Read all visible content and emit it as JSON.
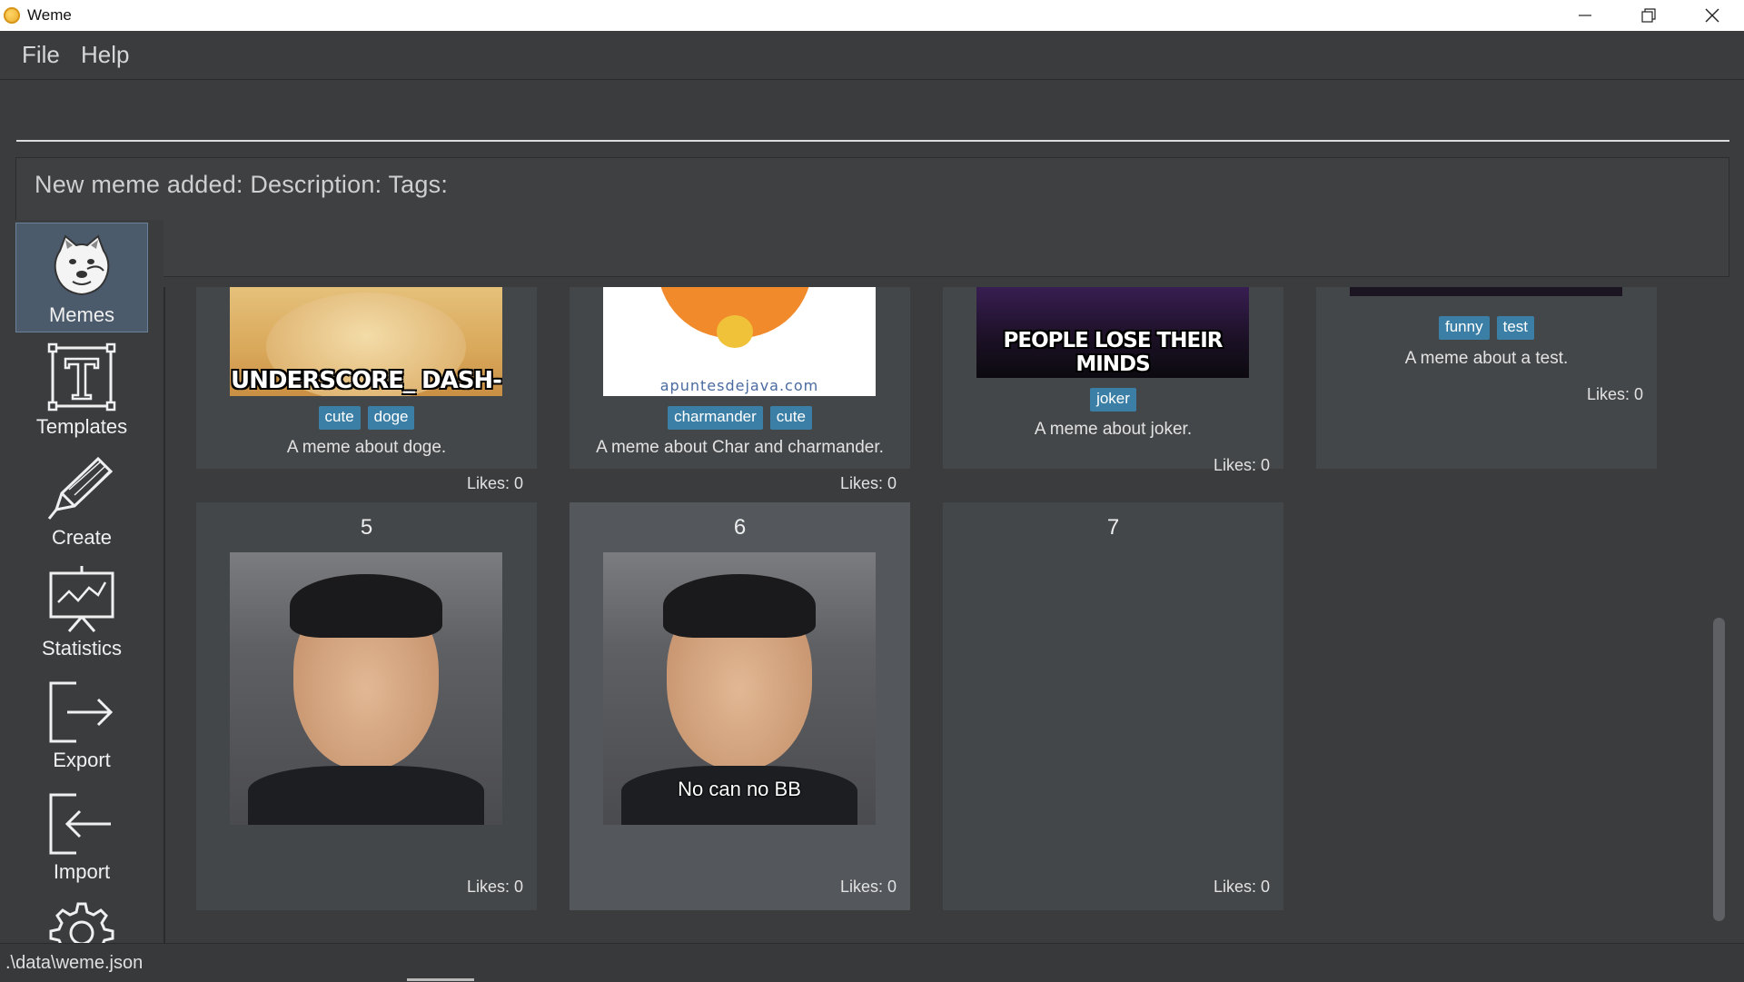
{
  "window": {
    "title": "Weme",
    "controls": {
      "minimize": "minimize-icon",
      "restore": "restore-icon",
      "close": "close-icon"
    }
  },
  "menu": {
    "file": "File",
    "help": "Help"
  },
  "command": {
    "value": "",
    "placeholder": ""
  },
  "result": {
    "text": "New meme added:  Description:  Tags:"
  },
  "sidebar": {
    "items": [
      {
        "label": "Memes",
        "icon": "doge-icon",
        "active": true
      },
      {
        "label": "Templates",
        "icon": "template-icon"
      },
      {
        "label": "Create",
        "icon": "pencil-icon"
      },
      {
        "label": "Statistics",
        "icon": "chart-board-icon"
      },
      {
        "label": "Export",
        "icon": "export-icon"
      },
      {
        "label": "Import",
        "icon": "import-icon"
      },
      {
        "label": "",
        "icon": "gear-icon"
      }
    ]
  },
  "memes": [
    {
      "index": "",
      "caption": "UNDERSCORE_ DASH-",
      "tags": [
        "cute",
        "doge"
      ],
      "description": "A meme about doge.",
      "likes": "Likes: 0"
    },
    {
      "index": "",
      "caption": "apuntesdejava.com",
      "tags": [
        "charmander",
        "cute"
      ],
      "description": "A meme about Char and charmander.",
      "likes": "Likes: 0"
    },
    {
      "index": "",
      "caption": "PEOPLE LOSE THEIR MINDS",
      "tags": [
        "joker"
      ],
      "description": "A meme about joker.",
      "likes": "Likes: 0"
    },
    {
      "index": "",
      "caption": "",
      "tags": [
        "funny",
        "test"
      ],
      "description": "A meme about a test.",
      "likes": "Likes: 0"
    },
    {
      "index": "5",
      "caption": "",
      "tags": [],
      "description": "",
      "likes": "Likes: 0"
    },
    {
      "index": "6",
      "caption": "No can no BB",
      "tags": [],
      "description": "",
      "likes": "Likes: 0",
      "selected": true
    },
    {
      "index": "7",
      "caption": "",
      "tags": [],
      "description": "",
      "likes": "Likes: 0"
    }
  ],
  "status": {
    "path": ".\\data\\weme.json"
  },
  "colors": {
    "background": "#3a3c3e",
    "accent_tag": "#3b7fa6",
    "active_nav": "#4c5b6c"
  }
}
